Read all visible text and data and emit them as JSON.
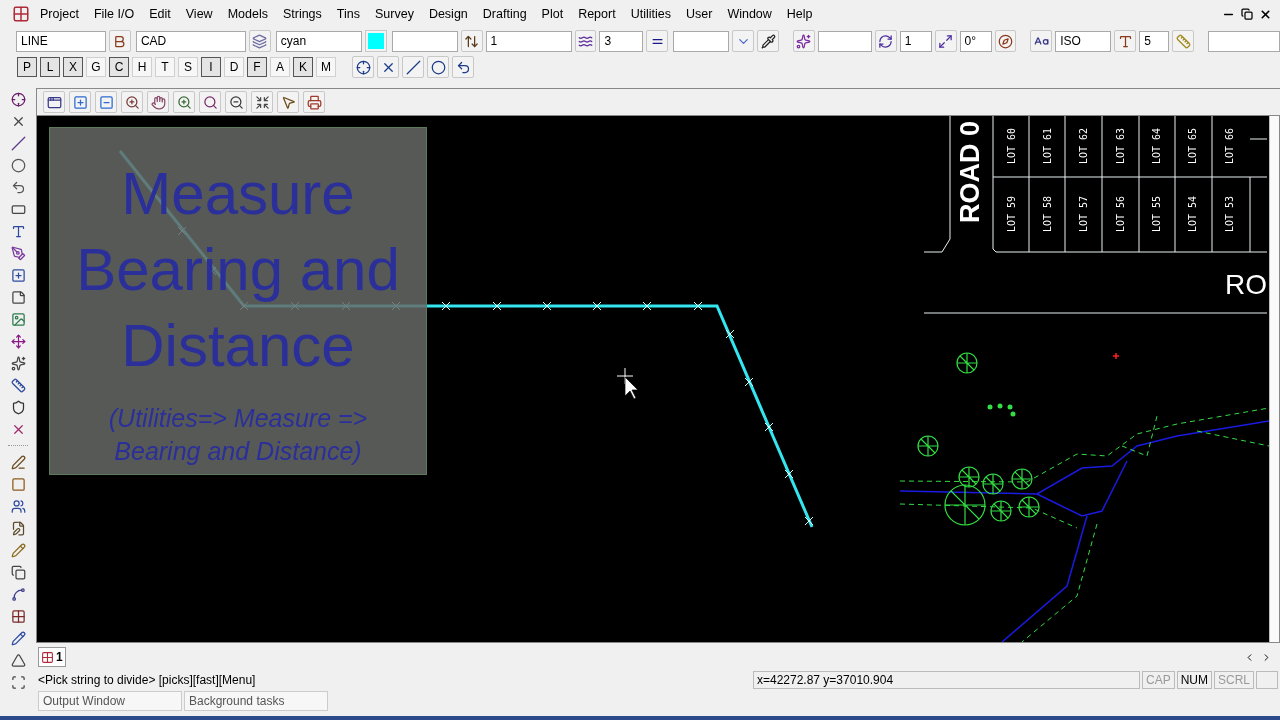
{
  "menu": [
    {
      "label": "Project"
    },
    {
      "label": "File I/O"
    },
    {
      "label": "Edit"
    },
    {
      "label": "View"
    },
    {
      "label": "Models"
    },
    {
      "label": "Strings"
    },
    {
      "label": "Tins"
    },
    {
      "label": "Survey"
    },
    {
      "label": "Design"
    },
    {
      "label": "Drafting"
    },
    {
      "label": "Plot"
    },
    {
      "label": "Report"
    },
    {
      "label": "Utilities"
    },
    {
      "label": "User"
    },
    {
      "label": "Window"
    },
    {
      "label": "Help"
    }
  ],
  "fields": [
    {
      "value": "LINE"
    },
    {
      "value": "CAD"
    },
    {
      "value": "cyan"
    },
    {
      "value": "1"
    },
    {
      "value": "3"
    },
    {
      "value": "1"
    },
    {
      "value": "0°"
    },
    {
      "value": "ISO"
    },
    {
      "value": "5"
    }
  ],
  "snap_buttons": [
    {
      "label": "P",
      "selected": true
    },
    {
      "label": "L",
      "selected": true
    },
    {
      "label": "X",
      "selected": true
    },
    {
      "label": "G",
      "selected": false
    },
    {
      "label": "C",
      "selected": true
    },
    {
      "label": "H",
      "selected": false
    },
    {
      "label": "T",
      "selected": false
    },
    {
      "label": "S",
      "selected": false
    },
    {
      "label": "I",
      "selected": true
    },
    {
      "label": "D",
      "selected": false
    },
    {
      "label": "F",
      "selected": true
    },
    {
      "label": "A",
      "selected": false
    },
    {
      "label": "K",
      "selected": true
    },
    {
      "label": "M",
      "selected": false
    }
  ],
  "canvas": {
    "overlay": {
      "title": "Measure Bearing and Distance",
      "subtitle": "(Utilities=> Measure => Bearing and Distance)"
    },
    "road_labels": [
      "ROAD 0",
      "RO"
    ],
    "lots_top": [
      "LOT 60",
      "LOT 61",
      "LOT 62",
      "LOT 63",
      "LOT 64",
      "LOT 65",
      "LOT 66"
    ],
    "lots_bottom": [
      "LOT 59",
      "LOT 58",
      "LOT 57",
      "LOT 56",
      "LOT 55",
      "LOT 54",
      "LOT 53"
    ]
  },
  "view_tabs": [
    {
      "label": "1",
      "selected": true
    }
  ],
  "status_bar": {
    "prompt": "<Pick string to divide> [picks][fast][Menu]",
    "coordinates": "x=42272.87 y=37010.904",
    "indicators": [
      {
        "label": "CAP",
        "on": false
      },
      {
        "label": "NUM",
        "on": true
      },
      {
        "label": "SCRL",
        "on": false
      }
    ]
  },
  "bottom_tabs": [
    {
      "label": "Output Window"
    },
    {
      "label": "Background tasks"
    }
  ]
}
